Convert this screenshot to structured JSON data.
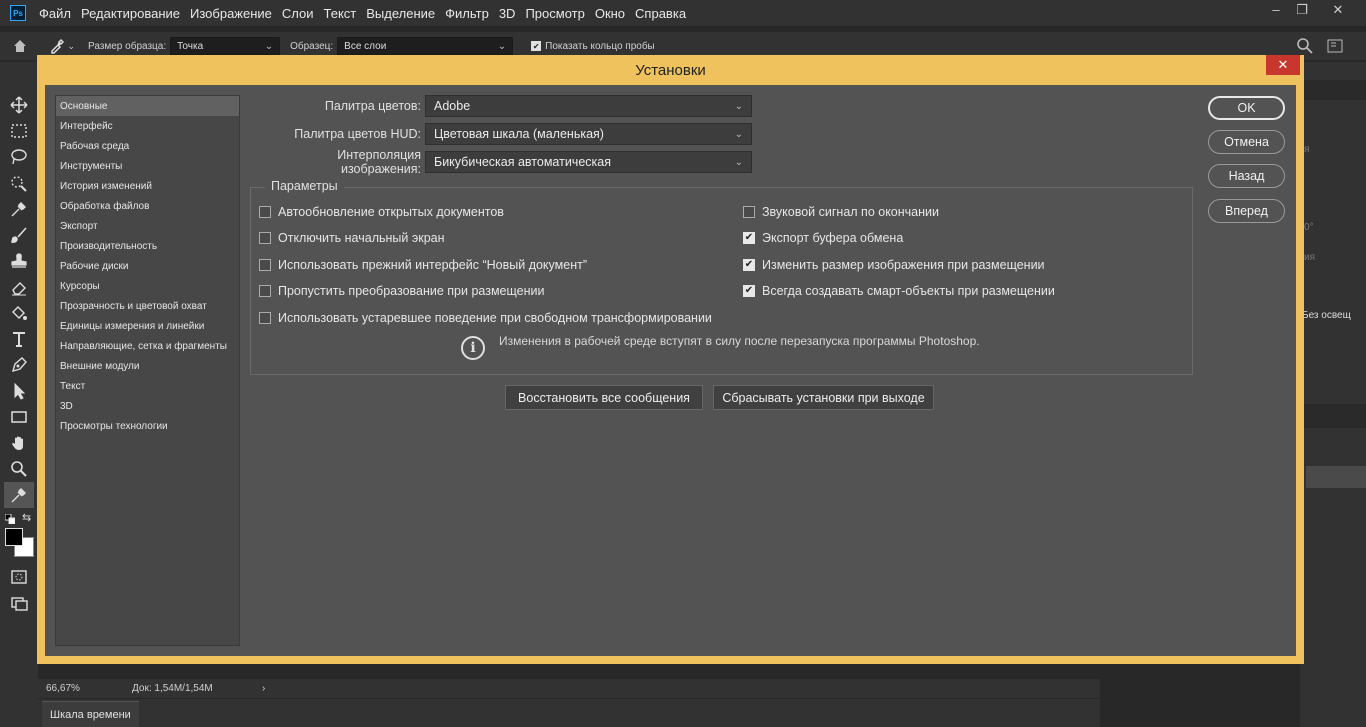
{
  "app": {
    "logo": "Ps"
  },
  "menubar": [
    "Файл",
    "Редактирование",
    "Изображение",
    "Слои",
    "Текст",
    "Выделение",
    "Фильтр",
    "3D",
    "Просмотр",
    "Окно",
    "Справка"
  ],
  "window_controls": {
    "minimize": "–",
    "restore": "❐",
    "close": "✕"
  },
  "options_bar": {
    "sample_size_label": "Размер образца:",
    "sample_size_value": "Точка",
    "sample_label": "Образец:",
    "sample_value": "Все слои",
    "show_ring_label": "Показать кольцо пробы",
    "show_ring_checked": true
  },
  "right_panel": {
    "text1": "я",
    "text2": "0°",
    "text3": "ия",
    "text4": "Без освещ"
  },
  "status": {
    "zoom": "66,67%",
    "doc": "Док: 1,54M/1,54M",
    "arrow": "›"
  },
  "timeline": {
    "tab": "Шкала времени"
  },
  "dialog": {
    "title": "Установки",
    "close": "✕",
    "categories": [
      "Основные",
      "Интерфейс",
      "Рабочая среда",
      "Инструменты",
      "История изменений",
      "Обработка файлов",
      "Экспорт",
      "Производительность",
      "Рабочие диски",
      "Курсоры",
      "Прозрачность и цветовой охват",
      "Единицы измерения и линейки",
      "Направляющие, сетка и фрагменты",
      "Внешние модули",
      "Текст",
      "3D",
      "Просмотры технологии"
    ],
    "active_category": "Основные",
    "fields": [
      {
        "label": "Палитра цветов:",
        "value": "Adobe"
      },
      {
        "label": "Палитра цветов HUD:",
        "value": "Цветовая шкала (маленькая)"
      },
      {
        "label": "Интерполяция изображения:",
        "value": "Бикубическая автоматическая"
      }
    ],
    "params_title": "Параметры",
    "options_left": [
      {
        "label": "Автообновление открытых документов",
        "checked": false
      },
      {
        "label": "Отключить начальный экран",
        "checked": false
      },
      {
        "label": "Использовать прежний интерфейс “Новый документ”",
        "checked": false
      },
      {
        "label": "Пропустить преобразование при размещении",
        "checked": false
      },
      {
        "label": "Использовать устаревшее поведение при свободном трансформировании",
        "checked": false
      }
    ],
    "options_right": [
      {
        "label": "Звуковой сигнал по окончании",
        "checked": false
      },
      {
        "label": "Экспорт буфера обмена",
        "checked": true
      },
      {
        "label": "Изменить размер изображения при размещении",
        "checked": true
      },
      {
        "label": "Всегда создавать смарт-объекты при размещении",
        "checked": true
      }
    ],
    "note": "Изменения в рабочей среде вступят в силу после перезапуска программы Photoshop.",
    "reset_messages": "Восстановить все сообщения",
    "reset_on_quit": "Сбрасывать установки при выходе",
    "buttons": {
      "ok": "OK",
      "cancel": "Отмена",
      "back": "Назад",
      "next": "Вперед"
    }
  },
  "colors": {
    "dialog_frame": "#efc25d",
    "dialog_bg": "#535353",
    "close_red": "#c7372e",
    "ui_dark": "#323232"
  }
}
